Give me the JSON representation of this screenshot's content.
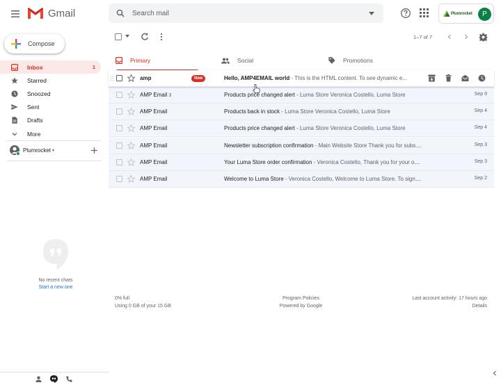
{
  "header": {
    "app_name": "Gmail",
    "search_placeholder": "Search mail",
    "account_avatar_letter": "P",
    "account_brand": "Plumrocket"
  },
  "sidebar": {
    "compose_label": "Compose",
    "items": [
      {
        "label": "Inbox",
        "count": "1",
        "icon": "inbox-icon"
      },
      {
        "label": "Starred",
        "count": "",
        "icon": "star-icon"
      },
      {
        "label": "Snoozed",
        "count": "",
        "icon": "clock-icon"
      },
      {
        "label": "Sent",
        "count": "",
        "icon": "send-icon"
      },
      {
        "label": "Drafts",
        "count": "",
        "icon": "draft-icon"
      },
      {
        "label": "More",
        "count": "",
        "icon": "chevron-down-icon"
      }
    ],
    "hangouts_user": "Plumrocket",
    "no_chats_text": "No recent chats",
    "start_new_text": "Start a new one"
  },
  "toolbar": {
    "pagination": "1–7 of 7"
  },
  "tabs": [
    {
      "label": "Primary",
      "icon": "inbox-icon"
    },
    {
      "label": "Social",
      "icon": "people-icon"
    },
    {
      "label": "Promotions",
      "icon": "tag-icon"
    }
  ],
  "emails": [
    {
      "sender": "amp",
      "count": "",
      "badge": "New",
      "subject": "Hello, AMP4EMAIL world",
      "snippet": " - This is the HTML content. To see dynamic e...",
      "date": "",
      "unread": true
    },
    {
      "sender": "AMP Email",
      "count": "3",
      "badge": "",
      "subject": "Products price changed alert",
      "snippet": " - Luma Store Veronica Costello, Luma Store",
      "date": "Sep 9",
      "unread": false
    },
    {
      "sender": "AMP Email",
      "count": "",
      "badge": "",
      "subject": "Products back in stock",
      "snippet": " - Luma Store Veronica Costello, Luma Store",
      "date": "Sep 4",
      "unread": false
    },
    {
      "sender": "AMP Email",
      "count": "",
      "badge": "",
      "subject": "Products price changed alert",
      "snippet": " - Luma Store Veronica Costello, Luma Store",
      "date": "Sep 4",
      "unread": false
    },
    {
      "sender": "AMP Email",
      "count": "",
      "badge": "",
      "subject": "Newsletter subscription confirmation",
      "snippet": " - Main Website Store Thank you for subscri...",
      "date": "Sep 3",
      "unread": false
    },
    {
      "sender": "AMP Email",
      "count": "",
      "badge": "",
      "subject": "Your Luma Store order confirmation",
      "snippet": " - Veronica Costello, Thank you for your order ...",
      "date": "Sep 3",
      "unread": false
    },
    {
      "sender": "AMP Email",
      "count": "",
      "badge": "",
      "subject": "Welcome to Luma Store",
      "snippet": " - Veronica Costello, Welcome to Luma Store. To sign in t...",
      "date": "Sep 2",
      "unread": false
    }
  ],
  "footer": {
    "storage_percent": "0% full",
    "storage_detail": "Using 0 GB of your 15 GB",
    "program_policies": "Program Policies",
    "powered_by": "Powered by Google",
    "last_activity": "Last account activity: 17 hours ago",
    "details": "Details"
  },
  "colors": {
    "accent_red": "#d93025",
    "active_nav_bg": "#fce8e6",
    "read_row_bg": "#f2f6fc"
  }
}
